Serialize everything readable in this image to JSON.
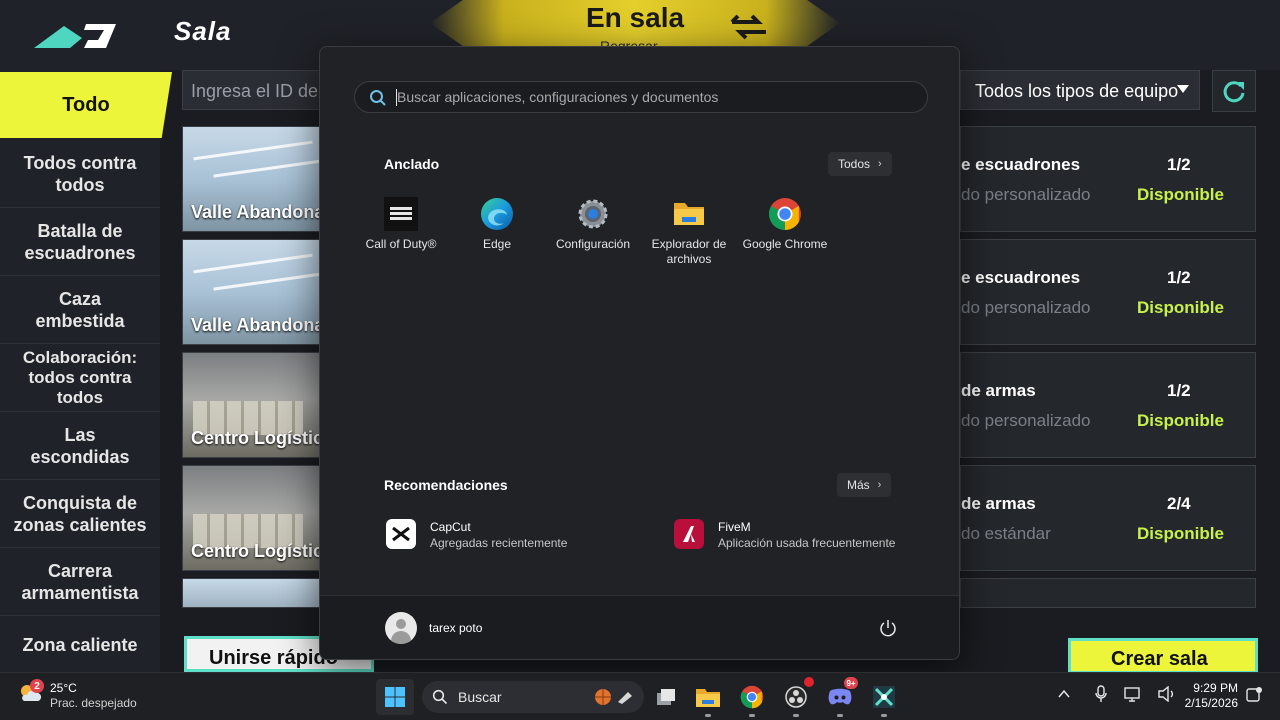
{
  "game": {
    "page_title": "Sala",
    "banner_title": "En sala",
    "banner_subtitle": "Regresar",
    "room_id_placeholder": "Ingresa el ID de",
    "equipment_filter": "Todos los tipos de equipo",
    "sidebar": [
      {
        "label": "Todo",
        "active": true
      },
      {
        "label": "Todos contra todos"
      },
      {
        "label": "Batalla de escuadrones"
      },
      {
        "label": "Caza embestida"
      },
      {
        "label": "Colaboración: todos contra todos"
      },
      {
        "label": "Las escondidas"
      },
      {
        "label": "Conquista de zonas calientes"
      },
      {
        "label": "Carrera armamentista"
      },
      {
        "label": "Zona caliente"
      }
    ],
    "maps": [
      {
        "name": "Valle Abandonado"
      },
      {
        "name": "Valle Abandonado"
      },
      {
        "name": "Centro Logístico"
      },
      {
        "name": "Centro Logístico"
      }
    ],
    "rooms": [
      {
        "title": "e escuadrones",
        "mode": "do personalizado",
        "count": "1/2",
        "status": "Disponible"
      },
      {
        "title": "e escuadrones",
        "mode": "do personalizado",
        "count": "1/2",
        "status": "Disponible"
      },
      {
        "title": "de armas",
        "mode": "do personalizado",
        "count": "1/2",
        "status": "Disponible"
      },
      {
        "title": "de armas",
        "mode": "do estándar",
        "count": "2/4",
        "status": "Disponible"
      }
    ],
    "quick_join_label": "Unirse rápido",
    "create_room_label": "Crear sala",
    "accent_color": "#ecf53a",
    "status_color": "#c7f24a"
  },
  "start_menu": {
    "search_placeholder": "Buscar aplicaciones, configuraciones y documentos",
    "pinned_title": "Anclado",
    "all_button": "Todos",
    "pinned_apps": [
      {
        "label": "Call of Duty®",
        "icon": "call-of-duty-icon"
      },
      {
        "label": "Edge",
        "icon": "edge-icon"
      },
      {
        "label": "Configuración",
        "icon": "settings-gear-icon"
      },
      {
        "label": "Explorador de archivos",
        "icon": "folder-icon"
      },
      {
        "label": "Google Chrome",
        "icon": "chrome-icon"
      }
    ],
    "recommended_title": "Recomendaciones",
    "more_button": "Más",
    "recommended": [
      {
        "name": "CapCut",
        "sub": "Agregadas recientemente",
        "icon": "capcut-icon"
      },
      {
        "name": "FiveM",
        "sub": "Aplicación usada frecuentemente",
        "icon": "fivem-icon"
      }
    ],
    "user_name": "tarex poto"
  },
  "taskbar": {
    "weather_temp": "25°C",
    "weather_desc": "Prac. despejado",
    "weather_badge": "2",
    "search_label": "Buscar",
    "discord_badge": "9+",
    "time": "9:29 PM",
    "date": "2/15/2026"
  }
}
